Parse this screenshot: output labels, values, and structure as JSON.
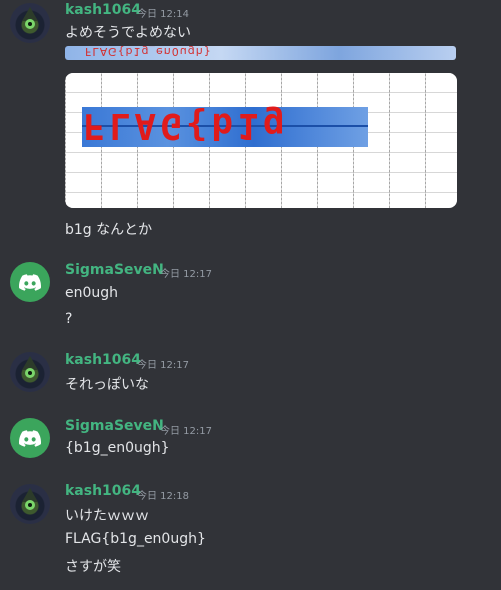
{
  "messages": [
    {
      "author": "kash1064",
      "time": "今日 12:14",
      "lines": [
        "よめそうでよめない"
      ],
      "image_strip_text": "FLAG{b1g_en0ugh}",
      "image_flag_text": "FLAG{b1g",
      "after_image_lines": [
        "b1g なんとか"
      ]
    },
    {
      "author": "SigmaSeveN",
      "time": "今日 12:17",
      "lines": [
        "en0ugh",
        "?"
      ]
    },
    {
      "author": "kash1064",
      "time": "今日 12:17",
      "lines": [
        "それっぽいな"
      ]
    },
    {
      "author": "SigmaSeveN",
      "time": "今日 12:17",
      "lines": [
        "{b1g_en0ugh}"
      ]
    },
    {
      "author": "kash1064",
      "time": "今日 12:18",
      "lines": [
        "いけたｗｗｗ",
        "FLAG{b1g_en0ugh}",
        "さすが笑"
      ]
    }
  ],
  "colors": {
    "background": "#313338",
    "username": "#43b581",
    "text": "#e3e5e8",
    "timestamp": "#949ba4"
  },
  "icons": {
    "user_avatar": "wizard-avatar-icon",
    "bot_avatar": "discord-logo-icon"
  }
}
